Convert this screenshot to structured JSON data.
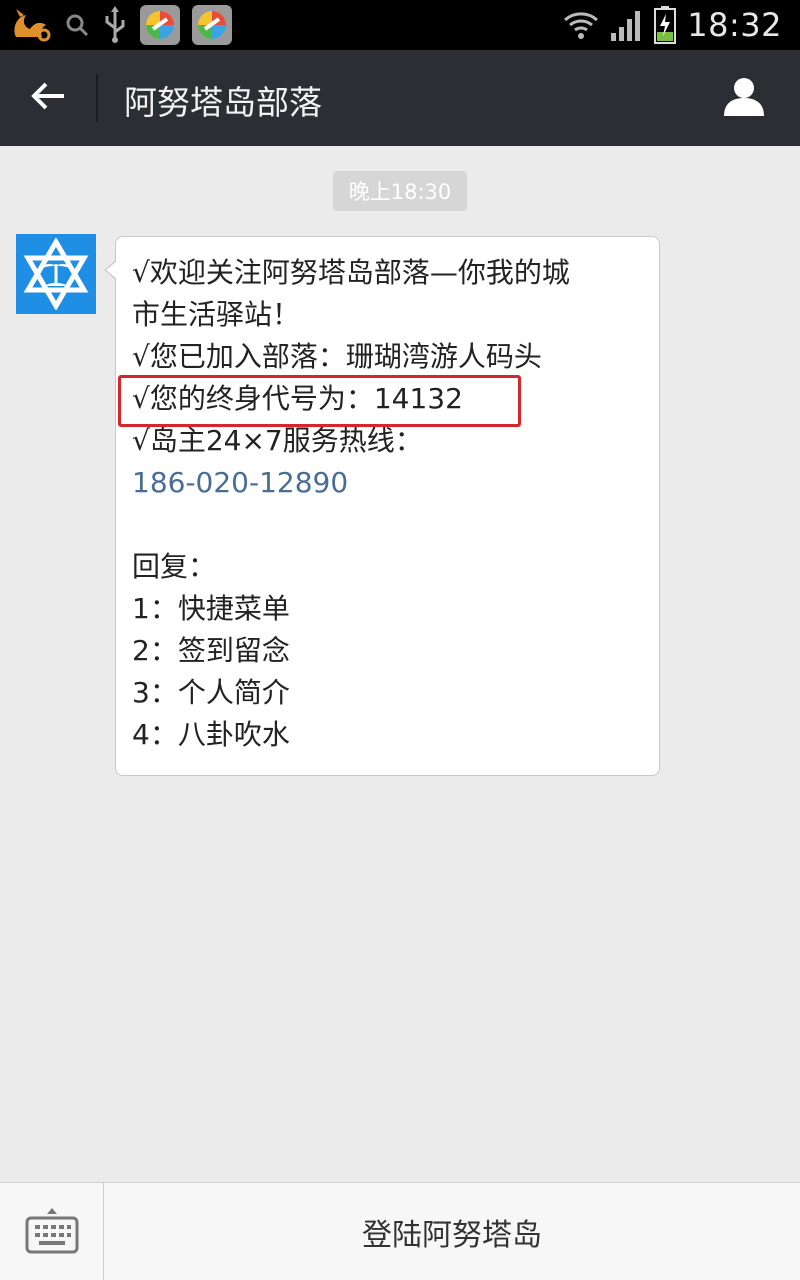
{
  "status_bar": {
    "time": "18:32",
    "icons": [
      "uc-browser-icon",
      "search-icon",
      "usb-icon",
      "app-store-icon",
      "app-store-icon",
      "wifi-icon",
      "signal-icon",
      "battery-charging-icon"
    ]
  },
  "header": {
    "title": "阿努塔岛部落",
    "icons": {
      "back": "back-arrow-icon",
      "profile": "person-icon"
    }
  },
  "chat": {
    "timestamp": "晚上18:30",
    "message": {
      "lines": [
        "√欢迎关注阿努塔岛部落—你我的城",
        "市生活驿站！",
        "√您已加入部落：珊瑚湾游人码头",
        "√您的终身代号为：14132",
        "√岛主24×7服务热线：",
        "186-020-12890",
        "",
        "回复：",
        "1：快捷菜单",
        "2：签到留念",
        "3：个人简介",
        "4：八卦吹水"
      ]
    }
  },
  "bottom_bar": {
    "menu_label": "登陆阿努塔岛",
    "keyboard_icon": "keyboard-icon"
  },
  "colors": {
    "title_bar": "#2b2f33",
    "background": "#ebebeb",
    "link": "#4a6d95",
    "highlight": "#d5272b",
    "avatar": "#1f8fe6"
  }
}
